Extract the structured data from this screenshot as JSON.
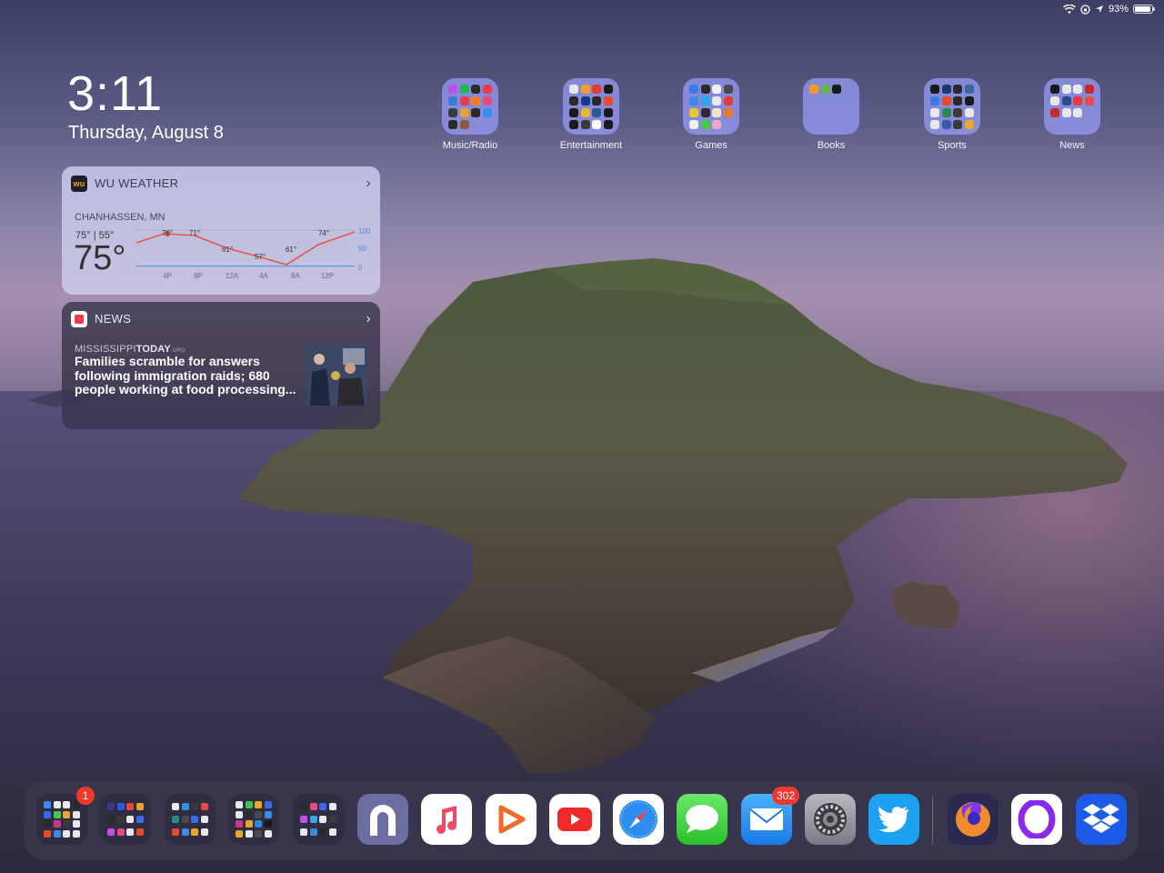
{
  "status_bar": {
    "battery_percent": "93%",
    "battery_level": 0.93,
    "icons": [
      "wifi-icon",
      "orientation-lock-icon",
      "location-icon",
      "battery-icon"
    ]
  },
  "clock": {
    "time": "3:11",
    "date": "Thursday, August 8"
  },
  "weather_widget": {
    "app_name": "WU WEATHER",
    "location": "CHANHASSEN, MN",
    "hi_lo": "75° | 55°",
    "current_temp": "75°",
    "chart_data": {
      "type": "line",
      "x": [
        "4P",
        "8P",
        "12A",
        "4A",
        "8A",
        "12P"
      ],
      "temp_labels": [
        "76°",
        "71°",
        "61°",
        "57°",
        "61°",
        "74°"
      ],
      "y_axis": [
        "100",
        "50",
        "0"
      ],
      "colors": {
        "temp_line": "#e2564c",
        "precip": "#4a9ee8"
      }
    }
  },
  "news_widget": {
    "app_name": "NEWS",
    "publisher": "MISSISSIPPI",
    "publisher_bold": "TODAY",
    "publisher_suffix": ".ORG",
    "headline": "Families scramble for answers following immigration raids; 680 people working at food processing..."
  },
  "folders": [
    {
      "label": "Music/Radio",
      "icon_colors": [
        "#c04ee8",
        "#1db954",
        "#2c2c2c",
        "#f0384c",
        "#3a7bd5",
        "#f0384c",
        "#f77d2a",
        "#e84a7c",
        "#3a3a3a",
        "#e8a52a",
        "#2a2a2a",
        "#3a8ef0",
        "#2a2a2a",
        "#8a5a3a"
      ]
    },
    {
      "label": "Entertainment",
      "icon_colors": [
        "#e8e8e8",
        "#f0a02a",
        "#e83a2a",
        "#1a1a1a",
        "#2a2a2a",
        "#1a3a8a",
        "#2a2a2a",
        "#e84a2a",
        "#1a1a1a",
        "#e8b82a",
        "#2a5a9a",
        "#1a1a1a",
        "#1a1a1a",
        "#3a3a3a",
        "#ffffff",
        "#1a1a1a"
      ]
    },
    {
      "label": "Games",
      "icon_colors": [
        "#3a7ae8",
        "#2a2a2a",
        "#f0f0f0",
        "#4a4a4a",
        "#3a8ae8",
        "#2aa8e8",
        "#e8e8e8",
        "#e83a3a",
        "#e8c82a",
        "#2a2a2a",
        "#f0e8c8",
        "#e87a2a",
        "#f0f0f0",
        "#4ac84a",
        "#e8a8c8"
      ]
    },
    {
      "label": "Books",
      "icon_colors": [
        "#f09a2a",
        "#6ab04c",
        "#1a1a1a"
      ]
    },
    {
      "label": "Sports",
      "icon_colors": [
        "#1a1a1a",
        "#1a3a6a",
        "#2a2a2a",
        "#3a6a9a",
        "#3a7ae8",
        "#e84a2a",
        "#2a2a2a",
        "#1a1a1a",
        "#e8e8e8",
        "#2a8a4a",
        "#3a3a3a",
        "#e8e8e8",
        "#e8e8e8",
        "#3a5aa8",
        "#3a3a3a",
        "#e8a82a"
      ]
    },
    {
      "label": "News",
      "icon_colors": [
        "#1a1a1a",
        "#e8e8e8",
        "#e8e8e8",
        "#c82a2a",
        "#e8e8e8",
        "#2a4a8a",
        "#e83a3a",
        "#e84a4a",
        "#c82a2a",
        "#e8e8e8",
        "#e8e8e8"
      ]
    }
  ],
  "dock": {
    "folders": [
      {
        "badge": "1",
        "icon_colors": [
          "#3a8ae8",
          "#e8e8e8",
          "#e8e8e8",
          "#2a2a2a",
          "#3a6ae8",
          "#4ac84a",
          "#e8a82a",
          "#e8e8e8",
          "#2a2a2a",
          "#c83a8a",
          "#3a3a3a",
          "#e8e8e8",
          "#e84a2a",
          "#3a8ae8",
          "#e8e8e8",
          "#e8e8e8"
        ]
      },
      {
        "badge": "",
        "icon_colors": [
          "#3a3a8a",
          "#2a5ae8",
          "#e84a2a",
          "#e8a82a",
          "#2a2a2a",
          "#3a3a3a",
          "#e8e8e8",
          "#3a6ae8",
          "#c84ae8",
          "#e84a7a",
          "#e8e8e8",
          "#e84a2a"
        ]
      },
      {
        "badge": "",
        "icon_colors": [
          "#e8e8e8",
          "#3a8ae8",
          "#3a3a3a",
          "#e84a3a",
          "#2a8a8a",
          "#4a4a4a",
          "#3a6ae8",
          "#e8e8e8",
          "#e84a2a",
          "#3a8ae8",
          "#e8a82a",
          "#e8e8e8"
        ]
      },
      {
        "badge": "",
        "icon_colors": [
          "#e8e8e8",
          "#3ac84a",
          "#e8a82a",
          "#3a6ae8",
          "#e8e8e8",
          "#2a2a2a",
          "#4a4a4a",
          "#3a8ae8",
          "#c83a8a",
          "#e8a82a",
          "#2a8ae8",
          "#1a1a1a",
          "#e8a82a",
          "#e8e8e8",
          "#4a4a4a",
          "#e8e8e8"
        ]
      },
      {
        "badge": "",
        "icon_colors": [
          "#2a2a2a",
          "#e84a7a",
          "#3a6ae8",
          "#e8e8e8",
          "#c84ae8",
          "#3aa8e8",
          "#e8e8e8",
          "#3a3a3a",
          "#e8e8e8",
          "#3a8ae8",
          "#2a2a2a",
          "#e8e8e8"
        ]
      }
    ],
    "apps": [
      {
        "name": "notchmeister-app-icon",
        "badge": ""
      },
      {
        "name": "music-app-icon",
        "badge": ""
      },
      {
        "name": "infuse-app-icon",
        "badge": ""
      },
      {
        "name": "youtube-app-icon",
        "badge": ""
      },
      {
        "name": "safari-app-icon",
        "badge": ""
      },
      {
        "name": "messages-app-icon",
        "badge": ""
      },
      {
        "name": "mail-app-icon",
        "badge": "302"
      },
      {
        "name": "settings-app-icon",
        "badge": ""
      },
      {
        "name": "twitter-app-icon",
        "badge": ""
      },
      {
        "name": "firefox-app-icon",
        "badge": ""
      },
      {
        "name": "opera-touch-app-icon",
        "badge": ""
      },
      {
        "name": "dropbox-app-icon",
        "badge": ""
      }
    ]
  }
}
